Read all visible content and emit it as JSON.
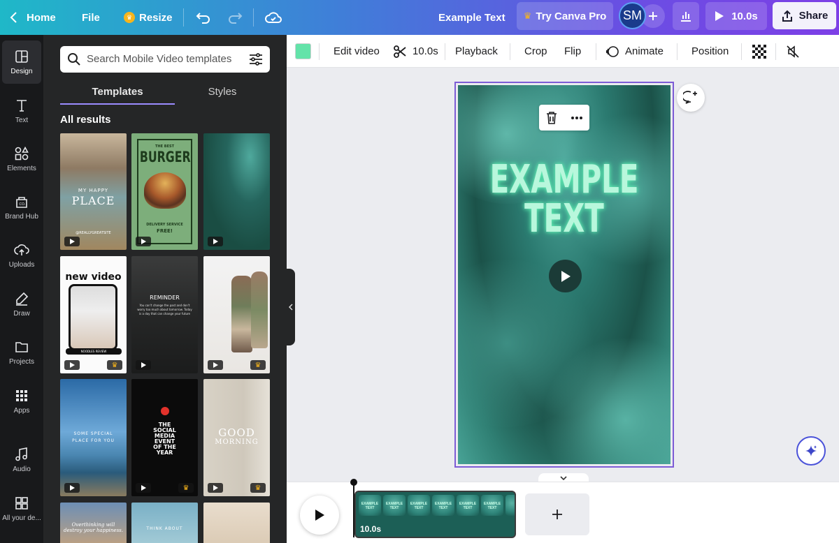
{
  "topbar": {
    "home_label": "Home",
    "file_label": "File",
    "resize_label": "Resize",
    "doc_title": "Example Text",
    "try_pro_label": "Try Canva Pro",
    "avatar_initials": "SM",
    "play_duration": "10.0s",
    "share_label": "Share"
  },
  "rail": {
    "items": [
      {
        "label": "Design",
        "icon": "layout-icon"
      },
      {
        "label": "Text",
        "icon": "text-icon"
      },
      {
        "label": "Elements",
        "icon": "shapes-icon"
      },
      {
        "label": "Brand Hub",
        "icon": "brand-icon"
      },
      {
        "label": "Uploads",
        "icon": "upload-cloud-icon"
      },
      {
        "label": "Draw",
        "icon": "pen-icon"
      },
      {
        "label": "Projects",
        "icon": "folder-icon"
      },
      {
        "label": "Apps",
        "icon": "apps-grid-icon"
      },
      {
        "label": "Audio",
        "icon": "music-note-icon"
      },
      {
        "label": "All your de...",
        "icon": "grid-icon"
      }
    ]
  },
  "panel": {
    "search_placeholder": "Search Mobile Video templates",
    "tabs": [
      "Templates",
      "Styles"
    ],
    "results_label": "All results",
    "thumbs": {
      "t1": [
        "MY HAPPY",
        "PLACE",
        "@REALLYGREATSITE"
      ],
      "t2": [
        "THE BEST",
        "BURGER",
        "DELIVERY SERVICE",
        "FREE!"
      ],
      "t4": [
        "new video",
        "NOODLES REVIEW"
      ],
      "t5": [
        "REMINDER",
        "You can't change the past and don't worry too much about tomorrow. Today is a day that can change your future"
      ],
      "t7": [
        "SOME SPECIAL",
        "PLACE FOR YOU"
      ],
      "t8": [
        "THE",
        "SOCIAL",
        "MEDIA",
        "EVENT",
        "OF THE",
        "YEAR"
      ],
      "t9": [
        "GOOD",
        "MORNING"
      ],
      "t10": [
        "Overthinking will destroy your happiness."
      ],
      "t11": [
        "THINK ABOUT"
      ]
    }
  },
  "toolbar": {
    "swatch_color": "#63e3a9",
    "edit_video": "Edit video",
    "trim_duration": "10.0s",
    "playback": "Playback",
    "crop": "Crop",
    "flip": "Flip",
    "animate": "Animate",
    "position": "Position"
  },
  "canvas": {
    "line1": "EXAMPLE",
    "line2": "TEXT"
  },
  "timeline": {
    "clip_duration": "10.0s",
    "frame_label": "EXAMPLE TEXT"
  }
}
